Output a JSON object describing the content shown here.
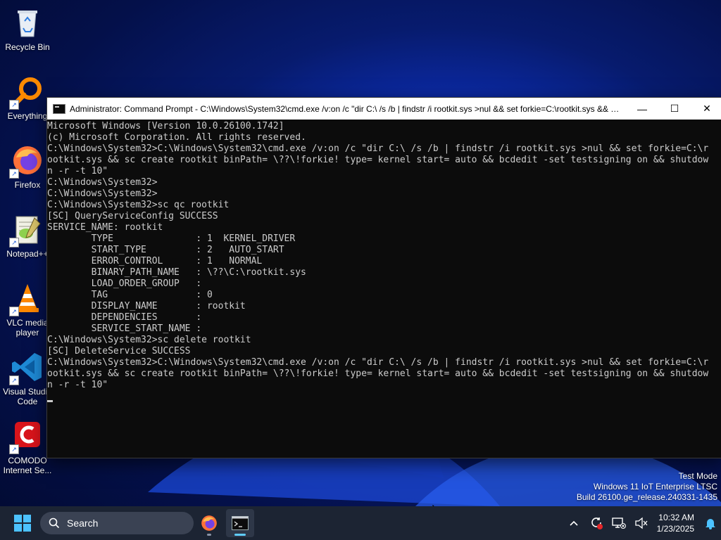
{
  "desktop": {
    "icons": [
      {
        "label": "Recycle Bin"
      },
      {
        "label": "Everything"
      },
      {
        "label": "Firefox"
      },
      {
        "label": "Notepad++"
      },
      {
        "label": "VLC media player"
      },
      {
        "label": "Visual Studio Code"
      },
      {
        "label": "COMODO Internet Se..."
      }
    ]
  },
  "window": {
    "title": "Administrator: Command Prompt - C:\\Windows\\System32\\cmd.exe  /v:on /c \"dir C:\\ /s /b | findstr /i rootkit.sys >nul && set forkie=C:\\rootkit.sys && sc...",
    "minimize": "—",
    "maximize": "☐",
    "close": "✕",
    "console_lines": [
      "Microsoft Windows [Version 10.0.26100.1742]",
      "(c) Microsoft Corporation. All rights reserved.",
      "",
      "C:\\Windows\\System32>C:\\Windows\\System32\\cmd.exe /v:on /c \"dir C:\\ /s /b | findstr /i rootkit.sys >nul && set forkie=C:\\r",
      "ootkit.sys && sc create rootkit binPath= \\??\\!forkie! type= kernel start= auto && bcdedit -set testsigning on && shutdow",
      "n -r -t 10\"",
      "",
      "C:\\Windows\\System32>",
      "C:\\Windows\\System32>",
      "C:\\Windows\\System32>sc qc rootkit",
      "[SC] QueryServiceConfig SUCCESS",
      "",
      "SERVICE_NAME: rootkit",
      "        TYPE               : 1  KERNEL_DRIVER",
      "        START_TYPE         : 2   AUTO_START",
      "        ERROR_CONTROL      : 1   NORMAL",
      "        BINARY_PATH_NAME   : \\??\\C:\\rootkit.sys",
      "        LOAD_ORDER_GROUP   :",
      "        TAG                : 0",
      "        DISPLAY_NAME       : rootkit",
      "        DEPENDENCIES       :",
      "        SERVICE_START_NAME :",
      "",
      "C:\\Windows\\System32>sc delete rootkit",
      "[SC] DeleteService SUCCESS",
      "",
      "C:\\Windows\\System32>C:\\Windows\\System32\\cmd.exe /v:on /c \"dir C:\\ /s /b | findstr /i rootkit.sys >nul && set forkie=C:\\r",
      "ootkit.sys && sc create rootkit binPath= \\??\\!forkie! type= kernel start= auto && bcdedit -set testsigning on && shutdow",
      "n -r -t 10\""
    ]
  },
  "watermark": {
    "line1": "Test Mode",
    "line2": "Windows 11 IoT Enterprise LTSC",
    "line3": "Build 26100.ge_release.240331-1435"
  },
  "taskbar": {
    "search_label": "Search",
    "time": "10:32 AM",
    "date": "1/23/2025"
  },
  "colors": {
    "accent": "#4cc2ff",
    "console_bg": "#0c0c0c",
    "console_fg": "#cccccc"
  }
}
